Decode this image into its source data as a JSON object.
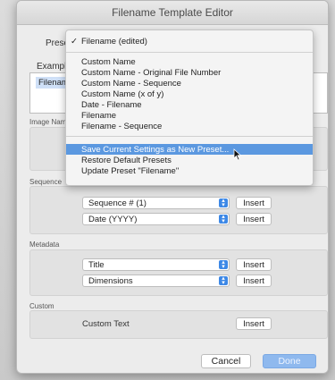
{
  "window": {
    "title": "Filename Template Editor"
  },
  "labels": {
    "preset": "Preset:",
    "example": "Example:",
    "image_name": "Image Name",
    "sequence": "Sequence",
    "metadata": "Metadata",
    "custom": "Custom"
  },
  "example_value": "Filename",
  "preset_menu": {
    "selected": "Filename (edited)",
    "check": "✓",
    "items": [
      "Custom Name",
      "Custom Name - Original File Number",
      "Custom Name - Sequence",
      "Custom Name (x of y)",
      "Date - Filename",
      "Filename",
      "Filename - Sequence"
    ],
    "actions": [
      "Save Current Settings as New Preset...",
      "Restore Default Presets",
      "Update Preset \"Filename\""
    ]
  },
  "sequence_rows": [
    {
      "value": "Sequence # (1)",
      "button": "Insert"
    },
    {
      "value": "Date (YYYY)",
      "button": "Insert"
    }
  ],
  "metadata_rows": [
    {
      "value": "Title",
      "button": "Insert"
    },
    {
      "value": "Dimensions",
      "button": "Insert"
    }
  ],
  "custom_row": {
    "label": "Custom Text",
    "button": "Insert"
  },
  "footer": {
    "cancel": "Cancel",
    "done": "Done"
  },
  "colors": {
    "accent": "#3d88e6",
    "highlight": "#5b98e0"
  }
}
